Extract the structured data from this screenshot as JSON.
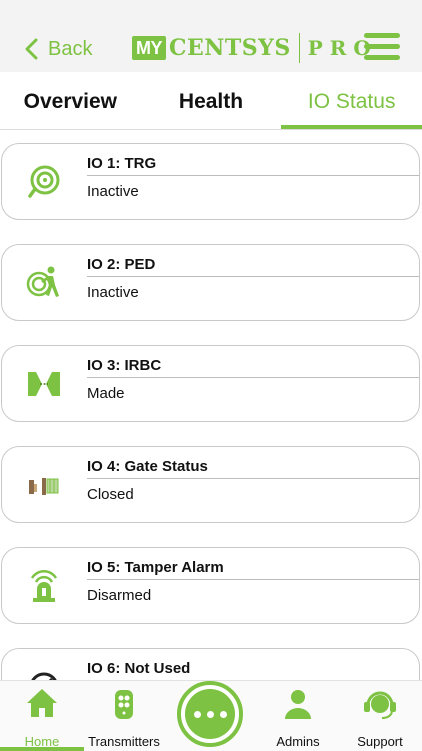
{
  "header": {
    "back_label": "Back",
    "logo": {
      "my": "MY",
      "brand": "CENTSYS",
      "suffix": "PRO"
    }
  },
  "tabs": [
    {
      "label": "Overview",
      "active": false
    },
    {
      "label": "Health",
      "active": false
    },
    {
      "label": "IO Status",
      "active": true
    }
  ],
  "io_items": [
    {
      "title": "IO 1: TRG",
      "status": "Inactive",
      "icon": "trigger-icon"
    },
    {
      "title": "IO 2: PED",
      "status": "Inactive",
      "icon": "pedestrian-icon"
    },
    {
      "title": "IO 3: IRBC",
      "status": "Made",
      "icon": "infrared-beam-icon"
    },
    {
      "title": "IO 4: Gate Status",
      "status": "Closed",
      "icon": "gate-status-icon"
    },
    {
      "title": "IO 5: Tamper Alarm",
      "status": "Disarmed",
      "icon": "alarm-siren-icon"
    },
    {
      "title": "IO 6: Not Used",
      "status": "",
      "icon": "not-used-icon"
    }
  ],
  "bottom_nav": [
    {
      "label": "Home",
      "icon": "home-icon",
      "active": true
    },
    {
      "label": "Transmitters",
      "icon": "remote-icon",
      "active": false
    },
    {
      "label": "",
      "icon": "more-icon",
      "active": false
    },
    {
      "label": "Admins",
      "icon": "user-icon",
      "active": false
    },
    {
      "label": "Support",
      "icon": "headset-icon",
      "active": false
    }
  ],
  "colors": {
    "accent": "#7dc242",
    "divider": "#bdbdbd",
    "gate_post": "#8b6a4a",
    "tan": "#c8a878"
  }
}
